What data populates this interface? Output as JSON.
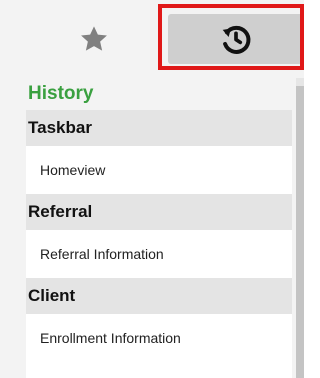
{
  "tabs": {
    "favorites_icon": "star-icon",
    "history_icon": "history-icon",
    "highlight_color": "#e01818"
  },
  "panel": {
    "title": "History",
    "title_color": "#3aa040"
  },
  "sections": [
    {
      "header": "Taskbar",
      "items": [
        "Homeview"
      ]
    },
    {
      "header": "Referral",
      "items": [
        "Referral Information"
      ]
    },
    {
      "header": "Client",
      "items": [
        "Enrollment Information"
      ]
    }
  ]
}
